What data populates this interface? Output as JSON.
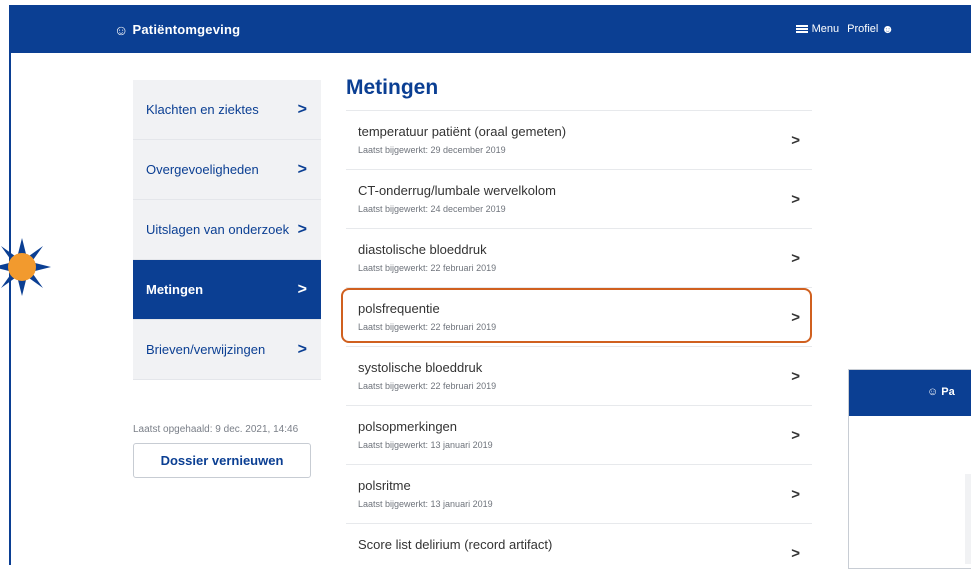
{
  "header": {
    "brand_icon": "user-circle-icon",
    "brand": "Patiëntomgeving",
    "menu_label": "Menu",
    "profile_label": "Profiel"
  },
  "sidebar": {
    "items": [
      {
        "label": "Klachten en ziektes",
        "active": false
      },
      {
        "label": "Overgevoeligheden",
        "active": false
      },
      {
        "label": "Uitslagen van onderzoek",
        "active": false
      },
      {
        "label": "Metingen",
        "active": true
      },
      {
        "label": "Brieven/verwijzingen",
        "active": false
      }
    ],
    "chevron": ">"
  },
  "fetched_text": "Laatst opgehaald: 9 dec. 2021, 14:46",
  "refresh_button": "Dossier vernieuwen",
  "main": {
    "title": "Metingen",
    "rows": [
      {
        "title": "temperatuur patiënt (oraal gemeten)",
        "subtitle": "Laatst bijgewerkt: 29 december 2019"
      },
      {
        "title": "CT-onderrug/lumbale wervelkolom",
        "subtitle": "Laatst bijgewerkt: 24 december 2019"
      },
      {
        "title": "diastolische bloeddruk",
        "subtitle": "Laatst bijgewerkt: 22 februari 2019"
      },
      {
        "title": "polsfrequentie",
        "subtitle": "Laatst bijgewerkt: 22 februari 2019"
      },
      {
        "title": "systolische bloeddruk",
        "subtitle": "Laatst bijgewerkt: 22 februari 2019"
      },
      {
        "title": "polsopmerkingen",
        "subtitle": "Laatst bijgewerkt: 13 januari 2019"
      },
      {
        "title": "polsritme",
        "subtitle": "Laatst bijgewerkt: 13 januari 2019"
      },
      {
        "title": "Score list delirium (record artifact)",
        "subtitle": ""
      }
    ],
    "chevron": ">"
  },
  "inset": {
    "brand": "Pa"
  },
  "colors": {
    "brand_blue": "#0b3f93",
    "highlight_orange": "#d0601f",
    "sun": "#f29a2e"
  }
}
